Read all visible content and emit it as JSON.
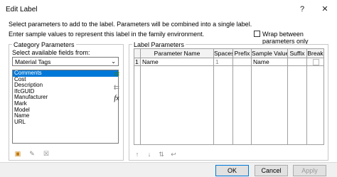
{
  "window": {
    "title": "Edit Label",
    "help": "?",
    "close": "✕"
  },
  "instructions": {
    "line1": "Select parameters to add to the label.  Parameters will be combined into a single label.",
    "line2": "Enter sample values to represent this label in the family environment."
  },
  "wrap_option": {
    "label": "Wrap between parameters only",
    "checked": false
  },
  "category": {
    "group_title": "Category Parameters",
    "fields_label": "Select available fields from:",
    "source": "Material Tags",
    "fields": [
      "Comments",
      "Cost",
      "Description",
      "IfcGUID",
      "Manufacturer",
      "Mark",
      "Model",
      "Name",
      "URL"
    ],
    "selected_index": 0
  },
  "side_icons": [
    "add-parameter-icon",
    "remove-parameter-icon",
    "edit-formula-icon"
  ],
  "side_glyphs": [
    "⇉",
    "⇇",
    "fx"
  ],
  "left_bottom_icons": [
    "new-parameter-icon",
    "edit-parameter-icon",
    "delete-parameter-icon"
  ],
  "left_bottom_glyphs": [
    "▣",
    "✎",
    "☒"
  ],
  "label_params": {
    "group_title": "Label Parameters",
    "columns": [
      "Parameter Name",
      "Spaces",
      "Prefix",
      "Sample Value",
      "Suffix",
      "Break"
    ],
    "rows": [
      {
        "num": "1",
        "name": "Name",
        "spaces": "1",
        "prefix": "",
        "sample": "Name",
        "suffix": "",
        "break": false
      }
    ]
  },
  "grid_bottom_icons": [
    "move-up-icon",
    "move-down-icon",
    "sort-icon",
    "wrap-icon"
  ],
  "grid_bottom_glyphs": [
    "↑",
    "↓",
    "⇅",
    "↩"
  ],
  "buttons": {
    "ok": "OK",
    "cancel": "Cancel",
    "apply": "Apply"
  }
}
